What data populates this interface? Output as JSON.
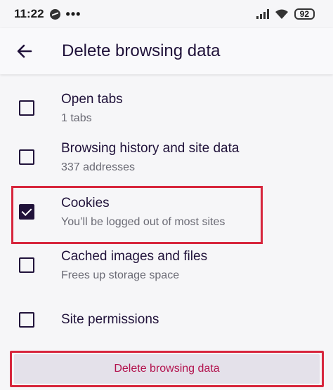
{
  "status_bar": {
    "time": "11:22",
    "more": "•••",
    "battery": "92"
  },
  "toolbar": {
    "title": "Delete browsing data"
  },
  "items": [
    {
      "label": "Open tabs",
      "sub": "1 tabs",
      "checked": false
    },
    {
      "label": "Browsing history and site data",
      "sub": "337 addresses",
      "checked": false
    },
    {
      "label": "Cookies",
      "sub": "You’ll be logged out of most sites",
      "checked": true
    },
    {
      "label": "Cached images and files",
      "sub": "Frees up storage space",
      "checked": false
    },
    {
      "label": "Site permissions",
      "sub": "",
      "checked": false
    }
  ],
  "action": {
    "delete_label": "Delete browsing data"
  },
  "colors": {
    "accent": "#b3134e",
    "highlight": "#d7263d",
    "text": "#20123a"
  }
}
